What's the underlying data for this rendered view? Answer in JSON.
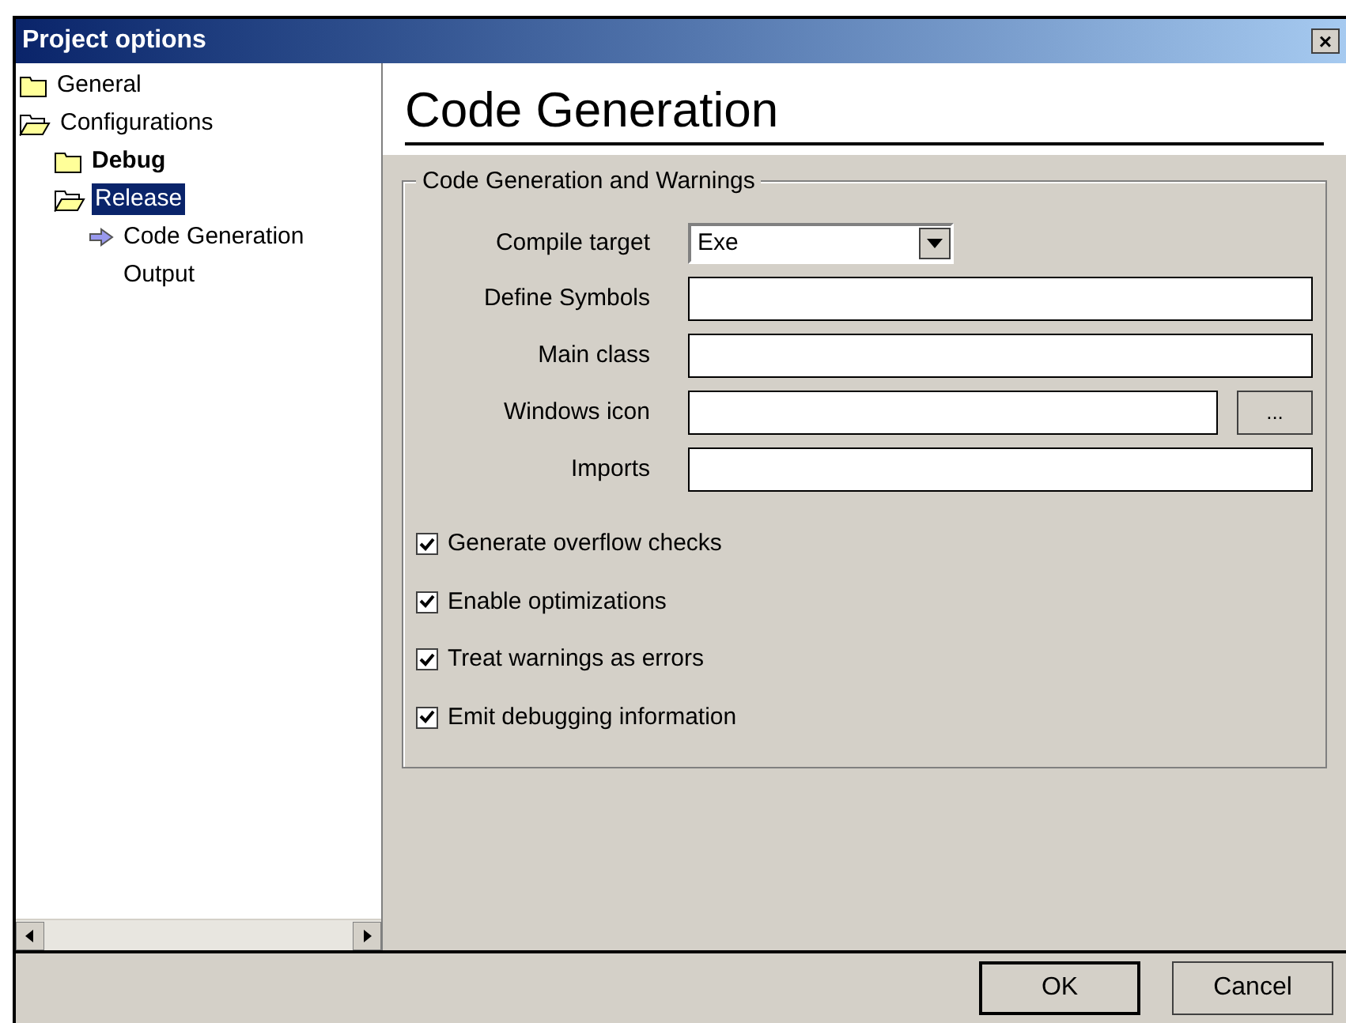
{
  "window": {
    "title": "Project options",
    "close": "×"
  },
  "tree": [
    {
      "label": "General",
      "kind": "folder",
      "selected": false,
      "bold": false
    },
    {
      "label": "Configurations",
      "kind": "folder-open",
      "selected": false,
      "bold": false,
      "children": [
        {
          "label": "Debug",
          "kind": "folder",
          "selected": false,
          "bold": true
        },
        {
          "label": "Release",
          "kind": "folder-open",
          "selected": true,
          "bold": false,
          "children": [
            {
              "label": "Code Generation",
              "kind": "arrow",
              "selected": false,
              "bold": false
            },
            {
              "label": "Output",
              "kind": "plain",
              "selected": false,
              "bold": false
            }
          ]
        }
      ]
    }
  ],
  "heading": "Code Generation",
  "group": {
    "title": "Code Generation and Warnings",
    "fields": [
      {
        "label": "Compile target",
        "kind": "dropdown",
        "value": "Exe"
      },
      {
        "label": "Define Symbols",
        "kind": "text"
      },
      {
        "label": "Main class",
        "kind": "text"
      },
      {
        "label": "Windows icon",
        "kind": "browse",
        "button": "..."
      },
      {
        "label": "Imports",
        "kind": "text"
      }
    ],
    "checkboxes": [
      {
        "label": "Generate overflow checks",
        "checked": true
      },
      {
        "label": "Enable optimizations",
        "checked": true
      },
      {
        "label": "Treat warnings as errors",
        "checked": true
      },
      {
        "label": "Emit debugging information",
        "checked": true
      }
    ]
  },
  "buttons": [
    "OK",
    "Cancel"
  ]
}
